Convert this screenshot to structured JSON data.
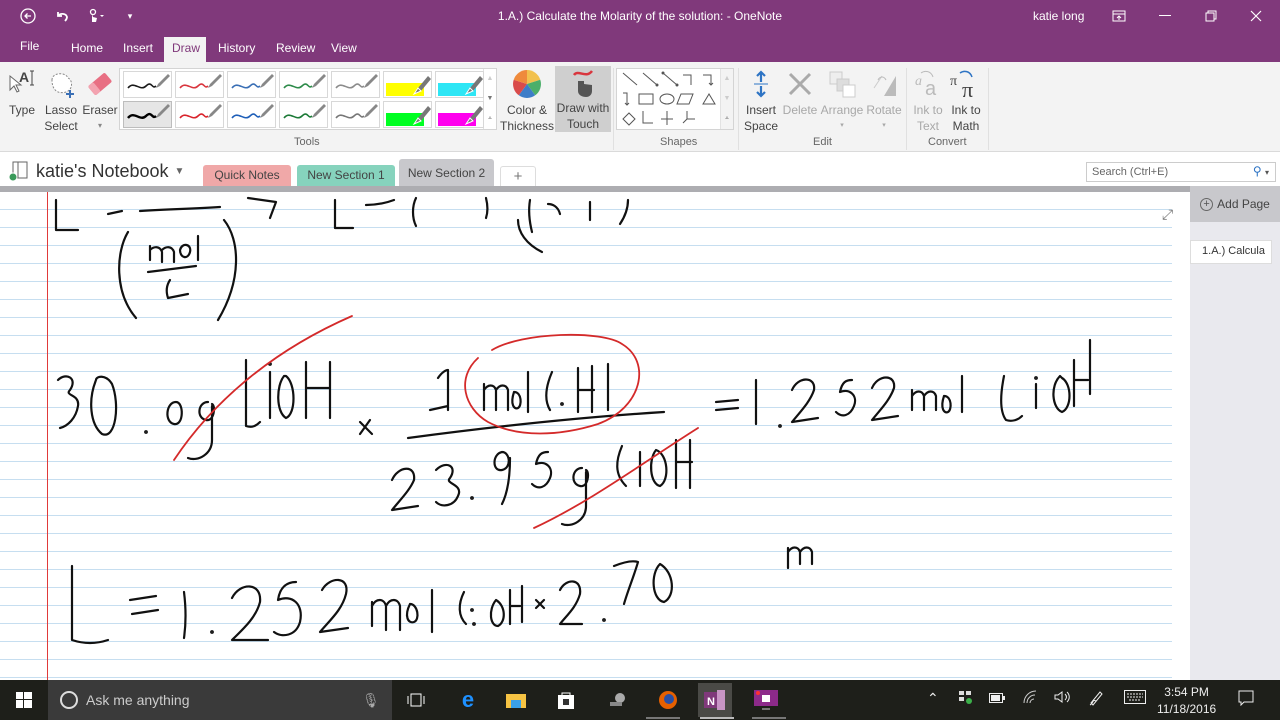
{
  "titlebar": {
    "title": "1.A.) Calculate the Molarity of the solution:  -  OneNote",
    "user": "katie long",
    "qat_icons": [
      "back-icon",
      "undo-icon",
      "touch-mode-icon",
      "customize-qat-icon"
    ],
    "window_buttons": [
      "ribbon-display-options-icon",
      "minimize-icon",
      "restore-icon",
      "close-icon"
    ]
  },
  "ribbon_tabs": [
    {
      "label": "File"
    },
    {
      "label": "Home"
    },
    {
      "label": "Insert"
    },
    {
      "label": "Draw",
      "active": true
    },
    {
      "label": "History"
    },
    {
      "label": "Review"
    },
    {
      "label": "View"
    }
  ],
  "ribbon": {
    "tools": {
      "type": "Type",
      "lasso_line1": "Lasso",
      "lasso_line2": "Select",
      "eraser": "Eraser",
      "eraser_arrow": "▾",
      "group_label": "Tools",
      "pens_row1": [
        {
          "kind": "pen",
          "color": "#1a1a1a"
        },
        {
          "kind": "pen",
          "color": "#d9363e"
        },
        {
          "kind": "pen",
          "color": "#3a6fb5"
        },
        {
          "kind": "pen",
          "color": "#2e8b4a"
        },
        {
          "kind": "pen",
          "color": "#8c8c8c"
        },
        {
          "kind": "highlighter",
          "color": "#ffff00"
        },
        {
          "kind": "highlighter",
          "color": "#2ee6f5"
        }
      ],
      "pens_row2": [
        {
          "kind": "pen",
          "color": "#000000",
          "selected": true
        },
        {
          "kind": "pen",
          "color": "#d9242c"
        },
        {
          "kind": "pen",
          "color": "#1f5fb8"
        },
        {
          "kind": "pen",
          "color": "#1c7a37"
        },
        {
          "kind": "pen",
          "color": "#777777"
        },
        {
          "kind": "highlighter",
          "color": "#00ff22"
        },
        {
          "kind": "highlighter",
          "color": "#ff00ee"
        }
      ]
    },
    "color_thickness_line1": "Color &",
    "color_thickness_line2": "Thickness",
    "draw_touch_line1": "Draw with",
    "draw_touch_line2": "Touch",
    "shapes_label": "Shapes",
    "shapes": [
      "line",
      "arrow",
      "double-arrow",
      "elbow",
      "elbow-arrow",
      "elbow-arrow-left",
      "rectangle",
      "ellipse",
      "parallelogram",
      "triangle",
      "diamond",
      "graph-xy",
      "graph-4quad",
      "graph-3d"
    ],
    "edit": {
      "insert_line1": "Insert",
      "insert_line2": "Space",
      "delete": "Delete",
      "arrange": "Arrange",
      "rotate": "Rotate",
      "group_label": "Edit"
    },
    "convert": {
      "ink_text_line1": "Ink to",
      "ink_text_line2": "Text",
      "ink_math_line1": "Ink to",
      "ink_math_line2": "Math",
      "group_label": "Convert"
    }
  },
  "notebook": {
    "name": "katie's Notebook",
    "sections": [
      {
        "label": "Quick Notes",
        "color": "#f0a8a8"
      },
      {
        "label": "New Section 1",
        "color": "#86d3bd"
      },
      {
        "label": "New Section 2",
        "color": "#c8c8cc",
        "active": true
      }
    ],
    "add_section": "+",
    "search_placeholder": "Search (Ctrl+E)"
  },
  "pages_panel": {
    "add_page": "Add Page",
    "pages": [
      {
        "title": "1.A.) Calcula"
      }
    ]
  },
  "canvas": {
    "handwriting_lines": [
      "L = g / (mol/L) → L = (mol)(mol)",
      "30.0g LiOH × 1 mol LiOH / 23.95 g LiOH = 1.252 mol LiOH",
      "L = 1.252 mol LiOH × 2.70 M"
    ],
    "ink_colors": {
      "black": "#111111",
      "red": "#d42a2a"
    }
  },
  "taskbar": {
    "search_placeholder": "Ask me anything",
    "apps": [
      "task-view-icon",
      "edge-icon",
      "file-explorer-icon",
      "store-icon",
      "network-app-icon",
      "firefox-icon",
      "onenote-icon",
      "screen-recorder-icon"
    ],
    "tray": [
      "show-hidden-icon",
      "dropbox-icon",
      "battery-icon",
      "wifi-icon",
      "volume-icon",
      "pen-icon",
      "keyboard-icon",
      "action-center-icon"
    ],
    "time": "3:54 PM",
    "date": "11/18/2016"
  }
}
